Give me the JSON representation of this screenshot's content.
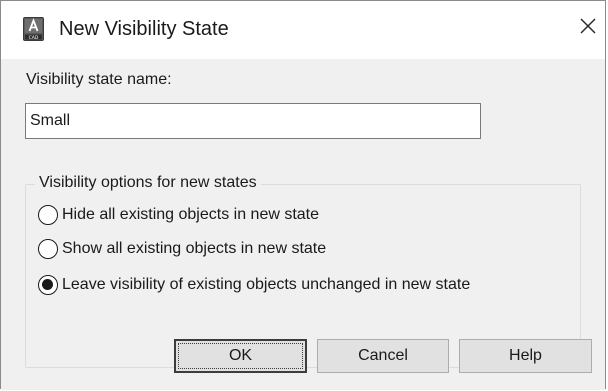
{
  "window": {
    "title": "New Visibility State",
    "icon": "autocad-app-icon",
    "close_glyph": "✕"
  },
  "form": {
    "name_label": "Visibility state name:",
    "name_value": "Small"
  },
  "options_group": {
    "legend": "Visibility options for new states",
    "options": [
      {
        "label": "Hide all existing objects in new state",
        "checked": false
      },
      {
        "label": "Show all existing objects in new state",
        "checked": false
      },
      {
        "label": "Leave visibility of existing objects unchanged in new state",
        "checked": true
      }
    ]
  },
  "buttons": {
    "ok": "OK",
    "cancel": "Cancel",
    "help": "Help"
  }
}
